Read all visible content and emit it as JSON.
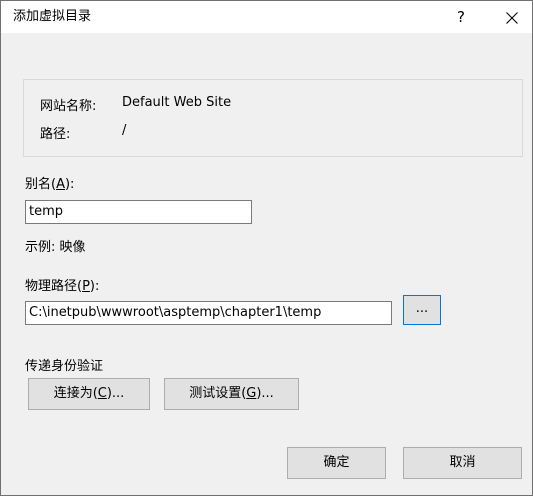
{
  "window": {
    "title": "添加虚拟目录",
    "help_label": "?",
    "close_icon": "close-icon"
  },
  "info": {
    "site_name_label": "网站名称:",
    "site_name_value": "Default Web Site",
    "path_label": "路径:",
    "path_value": "/"
  },
  "alias": {
    "label_pre": "别名(",
    "label_key": "A",
    "label_post": "):",
    "value": "temp",
    "example": "示例: 映像"
  },
  "physical_path": {
    "label_pre": "物理路径(",
    "label_key": "P",
    "label_post": "):",
    "value": "C:\\inetpub\\wwwroot\\asptemp\\chapter1\\temp",
    "browse_label": "..."
  },
  "auth": {
    "section_label": "传递身份验证",
    "connect_as_pre": "连接为(",
    "connect_as_key": "C",
    "connect_as_post": ")...",
    "test_settings_pre": "测试设置(",
    "test_settings_key": "G",
    "test_settings_post": ")..."
  },
  "footer": {
    "ok_label": "确定",
    "cancel_label": "取消"
  },
  "colors": {
    "dialog_bg": "#f0f0f0",
    "titlebar_bg": "#ffffff",
    "button_bg": "#e1e1e1",
    "focus_border": "#0078d7"
  }
}
